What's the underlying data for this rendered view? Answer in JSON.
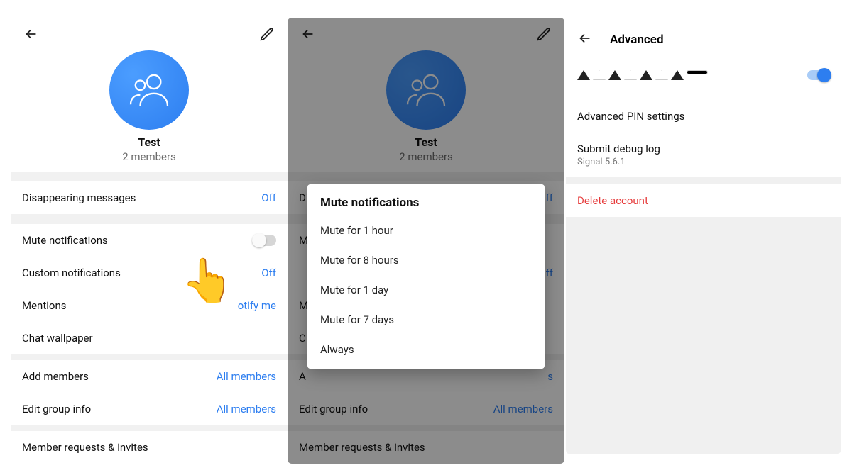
{
  "panel1": {
    "group_name": "Test",
    "members_sub": "2 members",
    "rows": {
      "disappearing": {
        "label": "Disappearing messages",
        "value": "Off"
      },
      "mute": {
        "label": "Mute notifications"
      },
      "custom_notif": {
        "label": "Custom notifications",
        "value": "Off"
      },
      "mentions": {
        "label": "Mentions",
        "value": "otify me"
      },
      "wallpaper": {
        "label": "Chat wallpaper"
      },
      "add_members": {
        "label": "Add members",
        "value": "All members"
      },
      "edit_group": {
        "label": "Edit group info",
        "value": "All members"
      },
      "requests": {
        "label": "Member requests & invites"
      }
    },
    "pointer_emoji": "👆"
  },
  "panel2": {
    "group_name": "Test",
    "members_sub": "2 members",
    "rows": {
      "disappearing": {
        "label": "Disappearing messages",
        "value": "Off"
      },
      "mute_row": {
        "label": "M"
      },
      "custom_notif_row": {
        "label": "",
        "value": "ff"
      },
      "mentions_row": {
        "label": "M"
      },
      "wallpaper_row": {
        "label": "C"
      },
      "add_members": {
        "label": "A",
        "value": "s"
      },
      "edit_group": {
        "label": "Edit group info",
        "value": "All members"
      },
      "requests": {
        "label": "Member requests & invites"
      }
    },
    "dialog": {
      "title": "Mute notifications",
      "options": [
        "Mute for 1 hour",
        "Mute for 8 hours",
        "Mute for 1 day",
        "Mute for 7 days",
        "Always"
      ]
    }
  },
  "panel3": {
    "header": "Advanced",
    "rows": {
      "pin": {
        "label": "Advanced PIN settings"
      },
      "debug": {
        "label": "Submit debug log",
        "sub": "Signal 5.6.1"
      },
      "delete": {
        "label": "Delete account"
      }
    }
  }
}
